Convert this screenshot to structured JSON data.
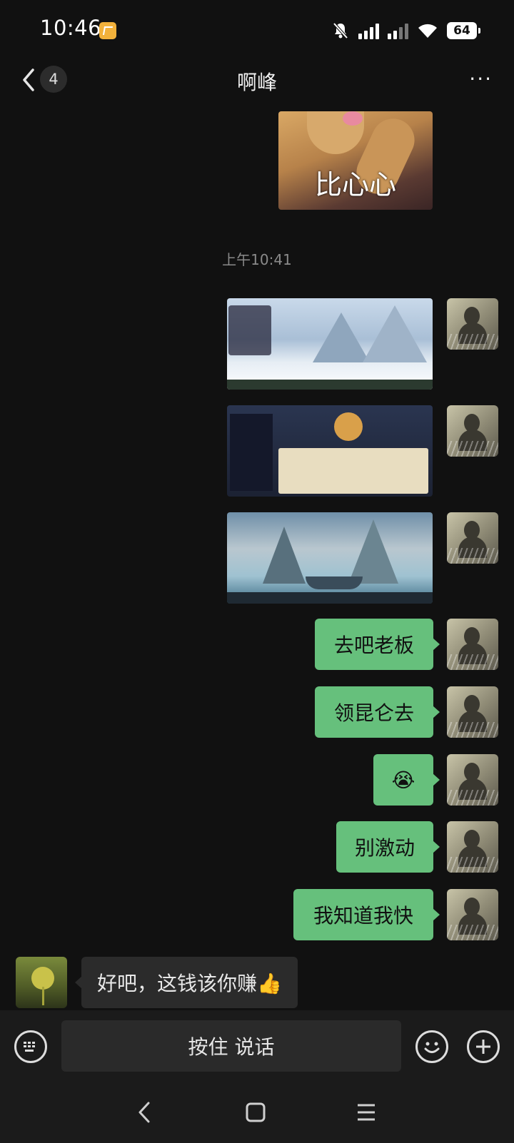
{
  "status_bar": {
    "time": "10:46",
    "battery": "64"
  },
  "header": {
    "back_count": "4",
    "title": "啊峰",
    "more": "···"
  },
  "chat": {
    "sticker_text": "比心心",
    "timestamp": "上午10:41",
    "outgoing_text": [
      "去吧老板",
      "领昆仑去",
      "😭",
      "别激动",
      "我知道我快"
    ],
    "incoming_text": "好吧，这钱该你赚👍"
  },
  "input_bar": {
    "voice_label": "按住 说话"
  },
  "colors": {
    "outgoing_bubble": "#66c07c",
    "background": "#111111",
    "incoming_bubble": "#2b2b2b"
  }
}
